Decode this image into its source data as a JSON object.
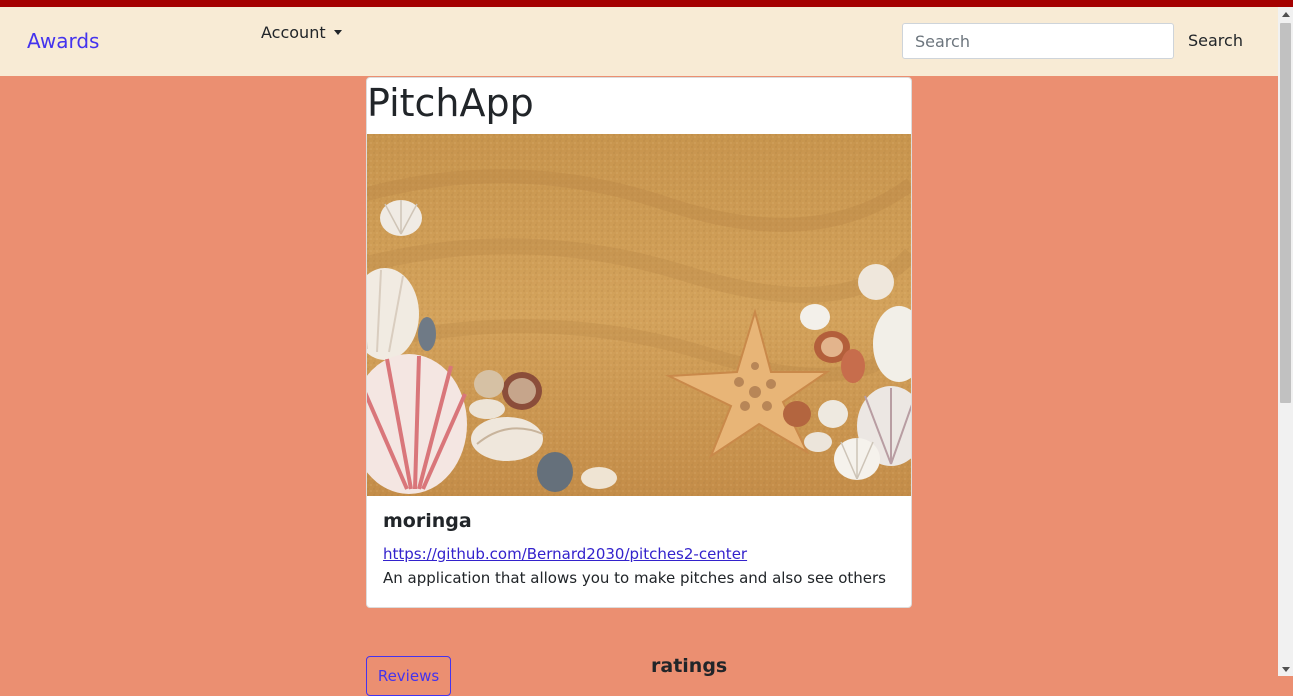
{
  "navbar": {
    "brand": "Awards",
    "account_label": "Account",
    "search_placeholder": "Search",
    "search_button": "Search",
    "colors": {
      "background": "#f8ebd5",
      "brand": "#4433ee",
      "top_stripe": "#a50000"
    }
  },
  "project": {
    "title": "PitchApp",
    "image_icon": "beach-seashells-image",
    "name": "moringa",
    "link": "https://github.com/Bernard2030/pitches2-center",
    "description": "An application that allows you to make pitches and also see others"
  },
  "actions": {
    "reviews_label": "Reviews",
    "ratings_heading": "ratings"
  },
  "page": {
    "background": "#eb8f71"
  }
}
